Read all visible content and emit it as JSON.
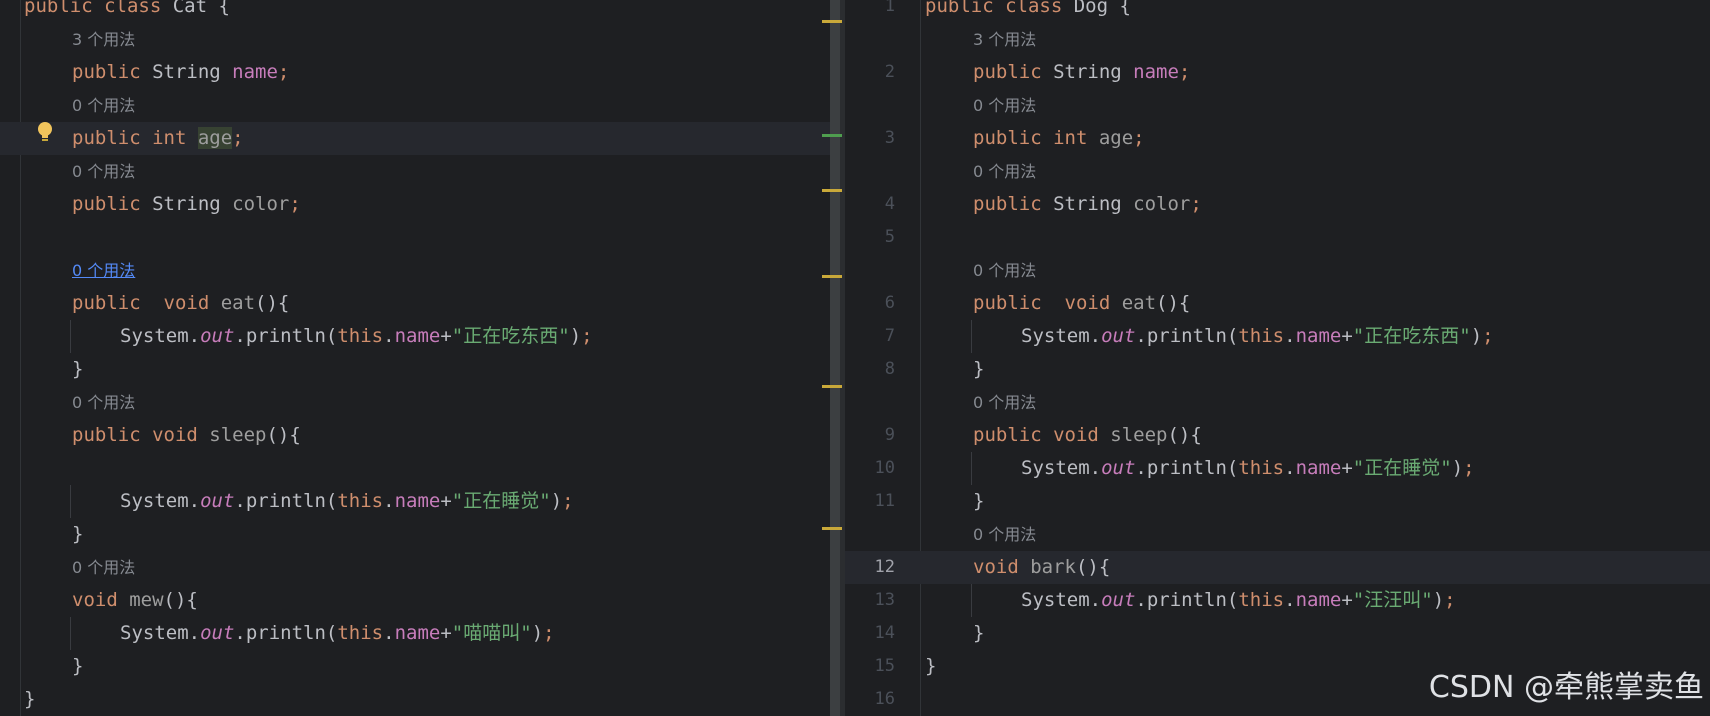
{
  "left": {
    "lines": [
      {
        "kind": "code",
        "tokens": [
          [
            "kw",
            "public "
          ],
          [
            "kw",
            "class "
          ],
          [
            "fn",
            "Cat "
          ],
          [
            "punc",
            "{"
          ]
        ]
      },
      {
        "kind": "hint",
        "text": "3 个用法"
      },
      {
        "kind": "code",
        "tokens": [
          [
            "kw",
            "public "
          ],
          [
            "fn",
            "String "
          ],
          [
            "fld",
            "name"
          ],
          [
            "semi",
            ";"
          ]
        ]
      },
      {
        "kind": "hint",
        "text": "0 个用法"
      },
      {
        "kind": "code",
        "hl": true,
        "tokens": [
          [
            "kw",
            "public "
          ],
          [
            "kw",
            "int "
          ],
          [
            "sel",
            "age"
          ],
          [
            "semi",
            ";"
          ]
        ]
      },
      {
        "kind": "hint",
        "text": "0 个用法"
      },
      {
        "kind": "code",
        "tokens": [
          [
            "kw",
            "public "
          ],
          [
            "fn",
            "String "
          ],
          [
            "fld-dim",
            "color"
          ],
          [
            "semi",
            ";"
          ]
        ]
      },
      {
        "kind": "blank"
      },
      {
        "kind": "hint",
        "link": true,
        "text": "0 个用法"
      },
      {
        "kind": "code",
        "tokens": [
          [
            "kw",
            "public  "
          ],
          [
            "kw",
            "void "
          ],
          [
            "fld-dim",
            "eat"
          ],
          [
            "punc",
            "(){"
          ]
        ]
      },
      {
        "kind": "code",
        "indent": 2,
        "tokens": [
          [
            "fn",
            "System."
          ],
          [
            "static",
            "out"
          ],
          [
            "fn",
            ".println("
          ],
          [
            "kw",
            "this"
          ],
          [
            "fn",
            "."
          ],
          [
            "fld",
            "name"
          ],
          [
            "fn",
            "+"
          ],
          [
            "str",
            "\"正在吃东西\""
          ],
          [
            "fn",
            ")"
          ],
          [
            "semi",
            ";"
          ]
        ]
      },
      {
        "kind": "code",
        "tokens": [
          [
            "punc",
            "}"
          ]
        ]
      },
      {
        "kind": "hint",
        "text": "0 个用法"
      },
      {
        "kind": "code",
        "tokens": [
          [
            "kw",
            "public "
          ],
          [
            "kw",
            "void "
          ],
          [
            "fld-dim",
            "sleep"
          ],
          [
            "punc",
            "(){"
          ]
        ]
      },
      {
        "kind": "blank"
      },
      {
        "kind": "code",
        "indent": 2,
        "tokens": [
          [
            "fn",
            "System."
          ],
          [
            "static",
            "out"
          ],
          [
            "fn",
            ".println("
          ],
          [
            "kw",
            "this"
          ],
          [
            "fn",
            "."
          ],
          [
            "fld",
            "name"
          ],
          [
            "fn",
            "+"
          ],
          [
            "str",
            "\"正在睡觉\""
          ],
          [
            "fn",
            ")"
          ],
          [
            "semi",
            ";"
          ]
        ]
      },
      {
        "kind": "code",
        "tokens": [
          [
            "punc",
            "}"
          ]
        ]
      },
      {
        "kind": "hint",
        "text": "0 个用法"
      },
      {
        "kind": "code",
        "tokens": [
          [
            "kw",
            "void "
          ],
          [
            "fld-dim",
            "mew"
          ],
          [
            "punc",
            "(){"
          ]
        ]
      },
      {
        "kind": "code",
        "indent": 2,
        "tokens": [
          [
            "fn",
            "System."
          ],
          [
            "static",
            "out"
          ],
          [
            "fn",
            ".println("
          ],
          [
            "kw",
            "this"
          ],
          [
            "fn",
            "."
          ],
          [
            "fld",
            "name"
          ],
          [
            "fn",
            "+"
          ],
          [
            "str",
            "\"喵喵叫\""
          ],
          [
            "fn",
            ")"
          ],
          [
            "semi",
            ";"
          ]
        ]
      },
      {
        "kind": "code",
        "tokens": [
          [
            "punc",
            "}"
          ]
        ]
      },
      {
        "kind": "code",
        "root": true,
        "tokens": [
          [
            "punc",
            "}"
          ]
        ]
      }
    ]
  },
  "right": {
    "lines": [
      {
        "kind": "code",
        "num": "1",
        "tokens": [
          [
            "kw",
            "public "
          ],
          [
            "kw",
            "class "
          ],
          [
            "fn",
            "Dog "
          ],
          [
            "punc",
            "{"
          ]
        ]
      },
      {
        "kind": "hint",
        "text": "3 个用法"
      },
      {
        "kind": "code",
        "num": "2",
        "tokens": [
          [
            "kw",
            "public "
          ],
          [
            "fn",
            "String "
          ],
          [
            "fld",
            "name"
          ],
          [
            "semi",
            ";"
          ]
        ]
      },
      {
        "kind": "hint",
        "text": "0 个用法"
      },
      {
        "kind": "code",
        "num": "3",
        "tokens": [
          [
            "kw",
            "public "
          ],
          [
            "kw",
            "int "
          ],
          [
            "fld-dim",
            "age"
          ],
          [
            "semi",
            ";"
          ]
        ]
      },
      {
        "kind": "hint",
        "text": "0 个用法"
      },
      {
        "kind": "code",
        "num": "4",
        "tokens": [
          [
            "kw",
            "public "
          ],
          [
            "fn",
            "String "
          ],
          [
            "fld-dim",
            "color"
          ],
          [
            "semi",
            ";"
          ]
        ]
      },
      {
        "kind": "blank",
        "num": "5"
      },
      {
        "kind": "hint",
        "text": "0 个用法"
      },
      {
        "kind": "code",
        "num": "6",
        "tokens": [
          [
            "kw",
            "public  "
          ],
          [
            "kw",
            "void "
          ],
          [
            "fld-dim",
            "eat"
          ],
          [
            "punc",
            "(){"
          ]
        ]
      },
      {
        "kind": "code",
        "num": "7",
        "indent": 2,
        "tokens": [
          [
            "fn",
            "System."
          ],
          [
            "static",
            "out"
          ],
          [
            "fn",
            ".println("
          ],
          [
            "kw",
            "this"
          ],
          [
            "fn",
            "."
          ],
          [
            "fld",
            "name"
          ],
          [
            "fn",
            "+"
          ],
          [
            "str",
            "\"正在吃东西\""
          ],
          [
            "fn",
            ")"
          ],
          [
            "semi",
            ";"
          ]
        ]
      },
      {
        "kind": "code",
        "num": "8",
        "tokens": [
          [
            "punc",
            "}"
          ]
        ]
      },
      {
        "kind": "hint",
        "text": "0 个用法"
      },
      {
        "kind": "code",
        "num": "9",
        "tokens": [
          [
            "kw",
            "public "
          ],
          [
            "kw",
            "void "
          ],
          [
            "fld-dim",
            "sleep"
          ],
          [
            "punc",
            "(){"
          ]
        ]
      },
      {
        "kind": "code",
        "num": "10",
        "indent": 2,
        "tokens": [
          [
            "fn",
            "System."
          ],
          [
            "static",
            "out"
          ],
          [
            "fn",
            ".println("
          ],
          [
            "kw",
            "this"
          ],
          [
            "fn",
            "."
          ],
          [
            "fld",
            "name"
          ],
          [
            "fn",
            "+"
          ],
          [
            "str",
            "\"正在睡觉\""
          ],
          [
            "fn",
            ")"
          ],
          [
            "semi",
            ";"
          ]
        ]
      },
      {
        "kind": "code",
        "num": "11",
        "tokens": [
          [
            "punc",
            "}"
          ]
        ]
      },
      {
        "kind": "hint",
        "text": "0 个用法"
      },
      {
        "kind": "code",
        "num": "12",
        "hl": true,
        "cur": true,
        "tokens": [
          [
            "kw",
            "void "
          ],
          [
            "fld-dim",
            "bark"
          ],
          [
            "punc",
            "(){"
          ]
        ]
      },
      {
        "kind": "code",
        "num": "13",
        "indent": 2,
        "tokens": [
          [
            "fn",
            "System."
          ],
          [
            "static",
            "out"
          ],
          [
            "fn",
            ".println("
          ],
          [
            "kw",
            "this"
          ],
          [
            "fn",
            "."
          ],
          [
            "fld",
            "name"
          ],
          [
            "fn",
            "+"
          ],
          [
            "str",
            "\"汪汪叫\""
          ],
          [
            "fn",
            ")"
          ],
          [
            "semi",
            ";"
          ]
        ]
      },
      {
        "kind": "code",
        "num": "14",
        "tokens": [
          [
            "punc",
            "}"
          ]
        ]
      },
      {
        "kind": "code",
        "num": "15",
        "root": true,
        "tokens": [
          [
            "punc",
            "}"
          ]
        ]
      },
      {
        "kind": "blank",
        "num": "16"
      }
    ]
  },
  "watermark": "CSDN @牵熊掌卖鱼",
  "colors": {
    "background": "#1e1f22",
    "keyword": "#cf8e6d",
    "field": "#c77dbb",
    "string": "#6aab73",
    "text": "#bcbec4",
    "hint": "#868a91",
    "marker": "#c9a93a"
  }
}
